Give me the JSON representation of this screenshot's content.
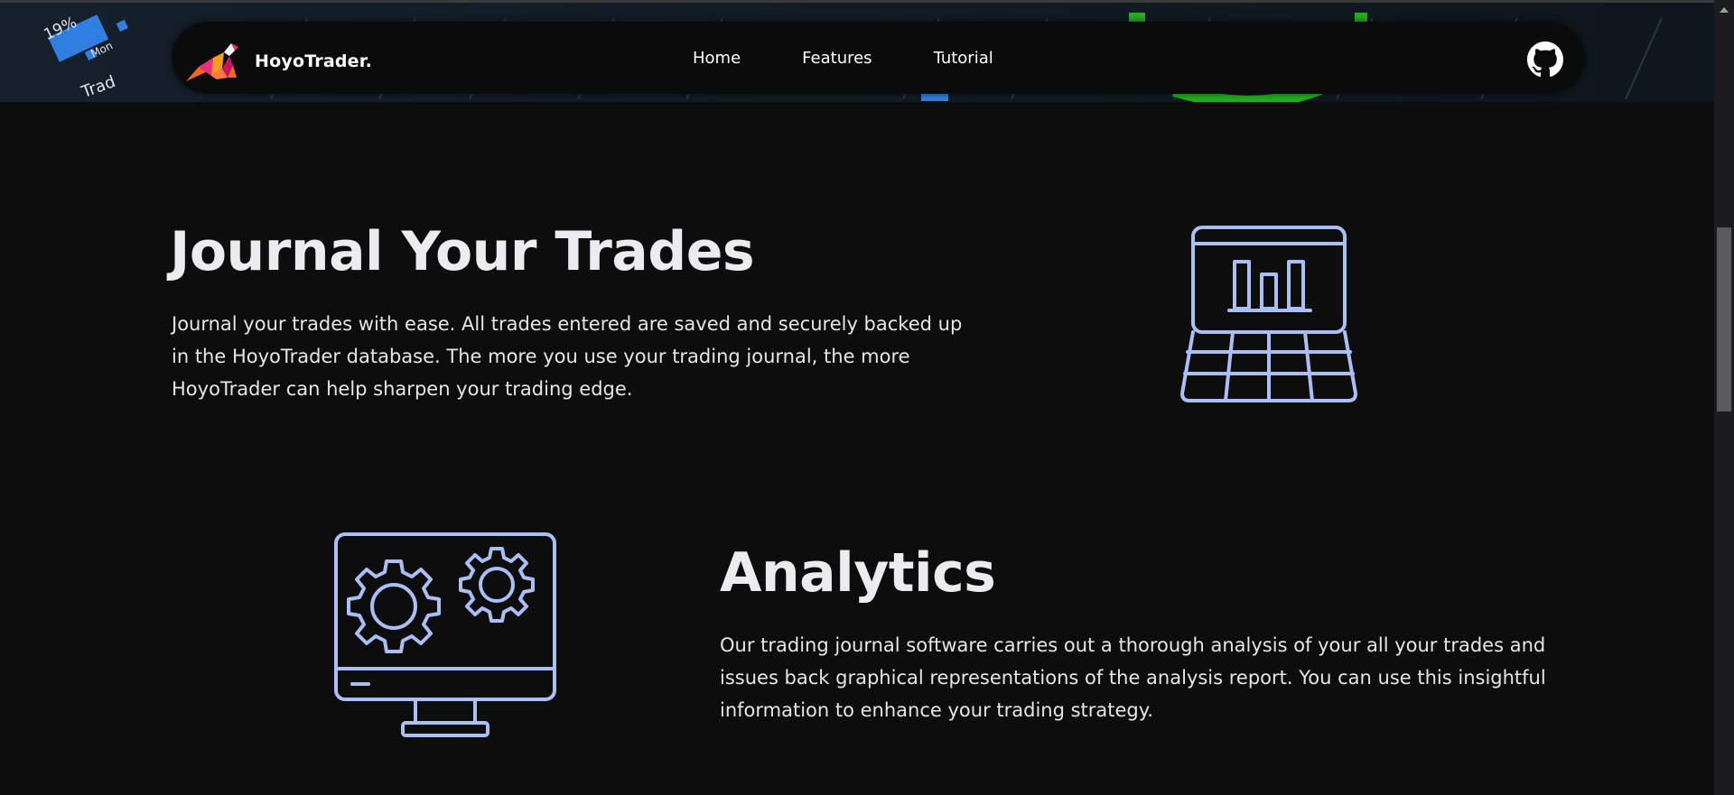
{
  "nav": {
    "brand": "HoyoTrader.",
    "links": [
      "Home",
      "Features",
      "Tutorial"
    ]
  },
  "background": {
    "labels": [
      "19%",
      "Mon",
      "Trad"
    ]
  },
  "sections": {
    "journal": {
      "title": "Journal Your Trades",
      "text": "Journal your trades with ease. All trades entered are saved and securely backed up in the HoyoTrader database. The more you use your trading journal, the more HoyoTrader can help sharpen your trading edge.",
      "icon": "laptop-chart-icon"
    },
    "analytics": {
      "title": "Analytics",
      "text": "Our trading journal software carries out a thorough analysis of your all your trades and issues back graphical representations of the analysis report. You can use this insightful information to enhance your trading strategy.",
      "icon": "monitor-gears-icon"
    }
  },
  "colors": {
    "background": "#0d0d0e",
    "navbar": "#0b0b0c",
    "accent_illustration": "#a9bff5",
    "text": "#e6e6ea",
    "logo_orange": "#f26522",
    "logo_pink": "#e8317a"
  },
  "icons": {
    "github": "github-icon",
    "brand": "kangaroo-logo-icon"
  }
}
